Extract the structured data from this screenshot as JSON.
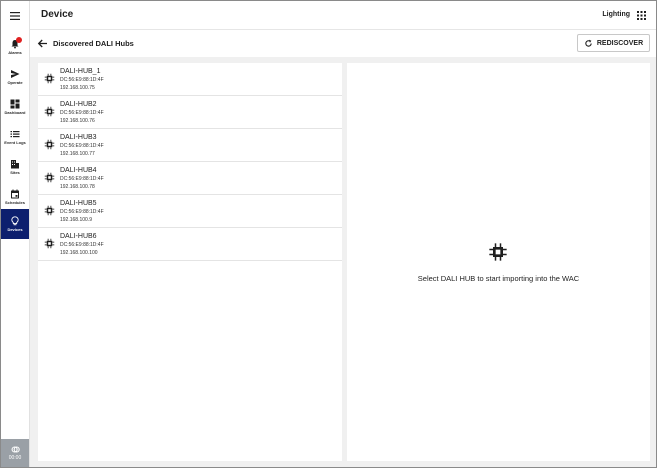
{
  "app": {
    "title": "Device",
    "context": "Lighting"
  },
  "sidebar": {
    "items": [
      {
        "label": "Alarms",
        "icon": "bell-icon",
        "badge": ""
      },
      {
        "label": "Operate",
        "icon": "send-icon"
      },
      {
        "label": "Dashboard",
        "icon": "dashboard-icon"
      },
      {
        "label": "Event Logs",
        "icon": "list-icon"
      },
      {
        "label": "Sites",
        "icon": "building-icon"
      },
      {
        "label": "Schedules",
        "icon": "calendar-icon"
      },
      {
        "label": "Devices",
        "icon": "bulb-icon",
        "active": true
      }
    ],
    "clock": "00:00"
  },
  "page": {
    "title": "Discovered DALI Hubs",
    "rediscover_label": "REDISCOVER"
  },
  "hubs": [
    {
      "name": "DALI-HUB_1",
      "mac": "DC:56:E9:88:1D:4F",
      "ip": "192.168.100.75"
    },
    {
      "name": "DALI-HUB2",
      "mac": "DC:56:E9:88:1D:4F",
      "ip": "192.168.100.76"
    },
    {
      "name": "DALI-HUB3",
      "mac": "DC:56:E9:88:1D:4F",
      "ip": "192.168.100.77"
    },
    {
      "name": "DALI-HUB4",
      "mac": "DC:56:E9:88:1D:4F",
      "ip": "192.168.100.78"
    },
    {
      "name": "DALI-HUB5",
      "mac": "DC:56:E9:88:1D:4F",
      "ip": "192.168.100.9"
    },
    {
      "name": "DALI-HUB6",
      "mac": "DC:56:E9:88:1D:4F",
      "ip": "192.168.100.100"
    }
  ],
  "empty_state": {
    "message": "Select DALI HUB to start importing into the WAC",
    "icon": "chip-icon"
  },
  "colors": {
    "active_nav": "#0d1f6e",
    "badge": "#e02020",
    "background": "#f0f0f0"
  }
}
